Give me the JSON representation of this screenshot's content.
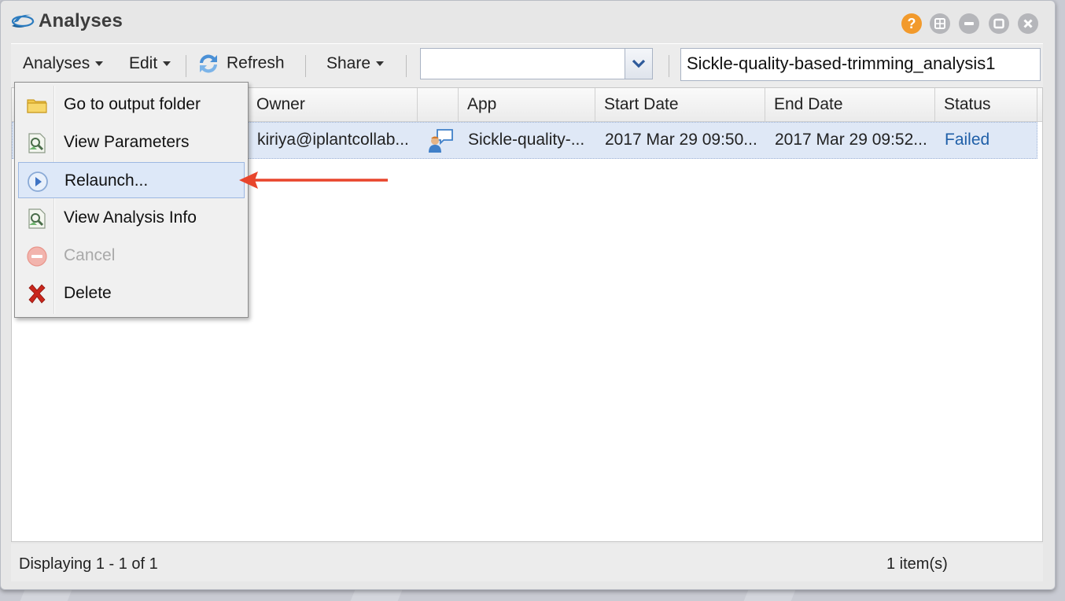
{
  "window": {
    "title": "Analyses",
    "help_label": "?"
  },
  "toolbar": {
    "analyses_label": "Analyses",
    "edit_label": "Edit",
    "refresh_label": "Refresh",
    "share_label": "Share",
    "combo_value": "",
    "search_value": "Sickle-quality-based-trimming_analysis1"
  },
  "grid": {
    "columns": [
      "Owner",
      "",
      "App",
      "Start Date",
      "End Date",
      "Status"
    ],
    "rows": [
      {
        "owner": "kiriya@iplantcollab...",
        "app": "Sickle-quality-...",
        "start_date": "2017 Mar 29 09:50...",
        "end_date": "2017 Mar 29 09:52...",
        "status": "Failed"
      }
    ]
  },
  "context_menu": {
    "items": [
      {
        "label": "Go to output folder",
        "icon": "folder-icon",
        "enabled": true
      },
      {
        "label": "View Parameters",
        "icon": "view-params-icon",
        "enabled": true
      },
      {
        "label": "Relaunch...",
        "icon": "relaunch-icon",
        "enabled": true,
        "highlighted": true
      },
      {
        "label": "View Analysis Info",
        "icon": "info-icon",
        "enabled": true
      },
      {
        "label": "Cancel",
        "icon": "cancel-icon",
        "enabled": false
      },
      {
        "label": "Delete",
        "icon": "delete-icon",
        "enabled": true
      }
    ]
  },
  "statusbar": {
    "displaying": "Displaying 1 - 1 of 1",
    "count": "1 item(s)"
  },
  "colors": {
    "status_failed": "#1f5fa8",
    "annotation_arrow": "#e8452c",
    "row_selected": "#dfe8f6",
    "help_button": "#f29a2c"
  }
}
